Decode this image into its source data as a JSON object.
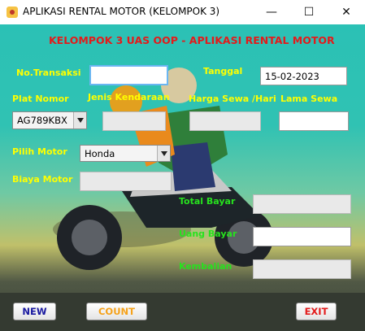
{
  "window": {
    "title": "APLIKASI RENTAL MOTOR (KELOMPOK 3)",
    "minimize": "—",
    "maximize": "☐",
    "close": "✕"
  },
  "heading": "KELOMPOK 3 UAS OOP - APLIKASI RENTAL MOTOR",
  "form": {
    "no_transaksi": {
      "label": "No.Transaksi",
      "value": ""
    },
    "tanggal": {
      "label": "Tanggal",
      "value": "15-02-2023"
    },
    "plat_nomor": {
      "label": "Plat Nomor",
      "selected": "AG789KBX"
    },
    "jenis_kendaraan": {
      "label": "Jenis Kendaraan",
      "value": ""
    },
    "harga_sewa": {
      "label": "Harga Sewa /Hari",
      "value": ""
    },
    "lama_sewa": {
      "label": "Lama Sewa",
      "value": ""
    },
    "pilih_motor": {
      "label": "Pilih Motor",
      "selected": "Honda"
    },
    "biaya_motor": {
      "label": "Biaya Motor",
      "value": ""
    },
    "total_bayar": {
      "label": "Total Bayar",
      "value": ""
    },
    "uang_bayar": {
      "label": "Uang Bayar",
      "value": ""
    },
    "kembalian": {
      "label": "Kembalian",
      "value": ""
    }
  },
  "buttons": {
    "new": "NEW",
    "count": "COUNT",
    "exit": "EXIT"
  },
  "colors": {
    "heading": "#e31b1b",
    "label_yellow": "#ffff00",
    "label_green": "#27e21e",
    "btn_new": "#1a1aa0",
    "btn_count": "#f5a21b",
    "btn_exit": "#e31b1b"
  }
}
